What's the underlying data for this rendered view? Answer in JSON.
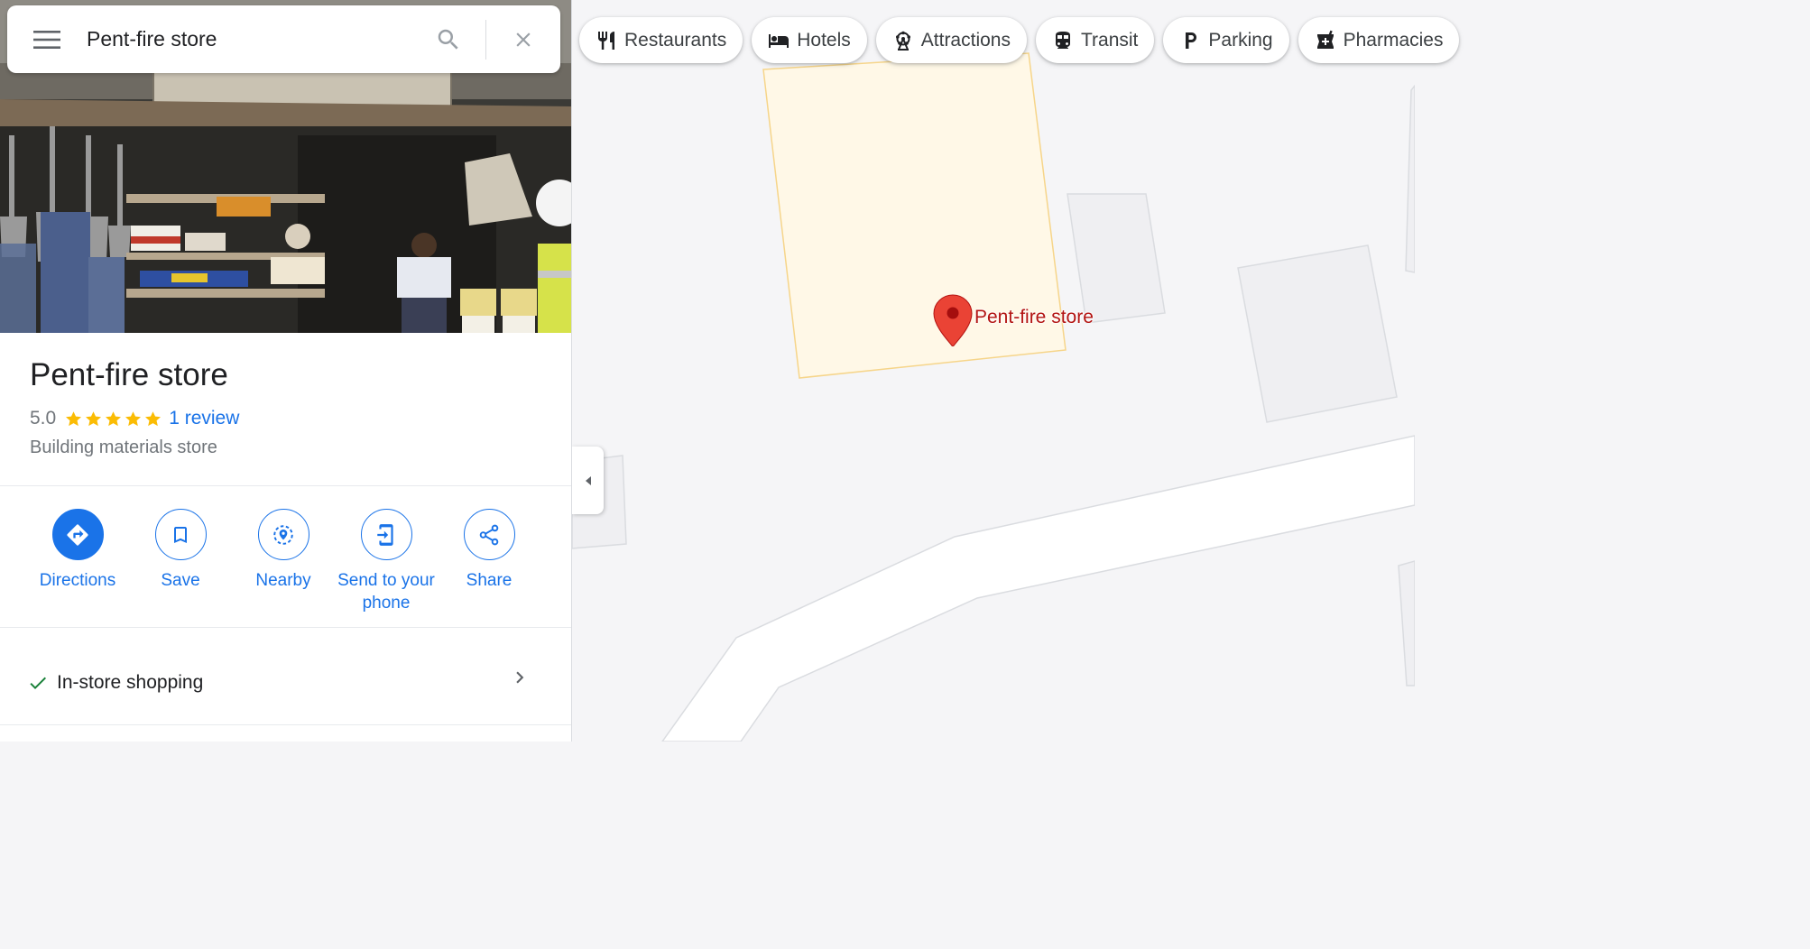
{
  "search": {
    "value": "Pent-fire store"
  },
  "place": {
    "name": "Pent-fire store",
    "rating": "5.0",
    "rating_fraction": 1.0,
    "star_count": 5,
    "reviews_label": "1 review",
    "category": "Building materials store"
  },
  "actions": [
    {
      "label": "Directions",
      "icon": "directions-icon"
    },
    {
      "label": "Save",
      "icon": "bookmark-icon"
    },
    {
      "label": "Nearby",
      "icon": "nearby-icon"
    },
    {
      "label": "Send to your phone",
      "icon": "send-to-phone-icon"
    },
    {
      "label": "Share",
      "icon": "share-icon"
    }
  ],
  "features": [
    {
      "label": "In-store shopping",
      "icon": "checkmark-icon"
    }
  ],
  "map": {
    "marker_label": "Pent-fire store"
  },
  "chips": [
    {
      "label": "Restaurants",
      "icon": "fork-knife-icon"
    },
    {
      "label": "Hotels",
      "icon": "bed-icon"
    },
    {
      "label": "Attractions",
      "icon": "ferris-wheel-icon"
    },
    {
      "label": "Transit",
      "icon": "train-icon"
    },
    {
      "label": "Parking",
      "icon": "parking-icon"
    },
    {
      "label": "Pharmacies",
      "icon": "pharmacy-icon"
    }
  ],
  "colors": {
    "accent": "#1a73e8",
    "star": "#fbbc04",
    "marker": "#ea4335",
    "marker_label": "#b31412",
    "check": "#188038",
    "highlight_fill": "#fff8e7",
    "highlight_stroke": "#f6d58a"
  }
}
